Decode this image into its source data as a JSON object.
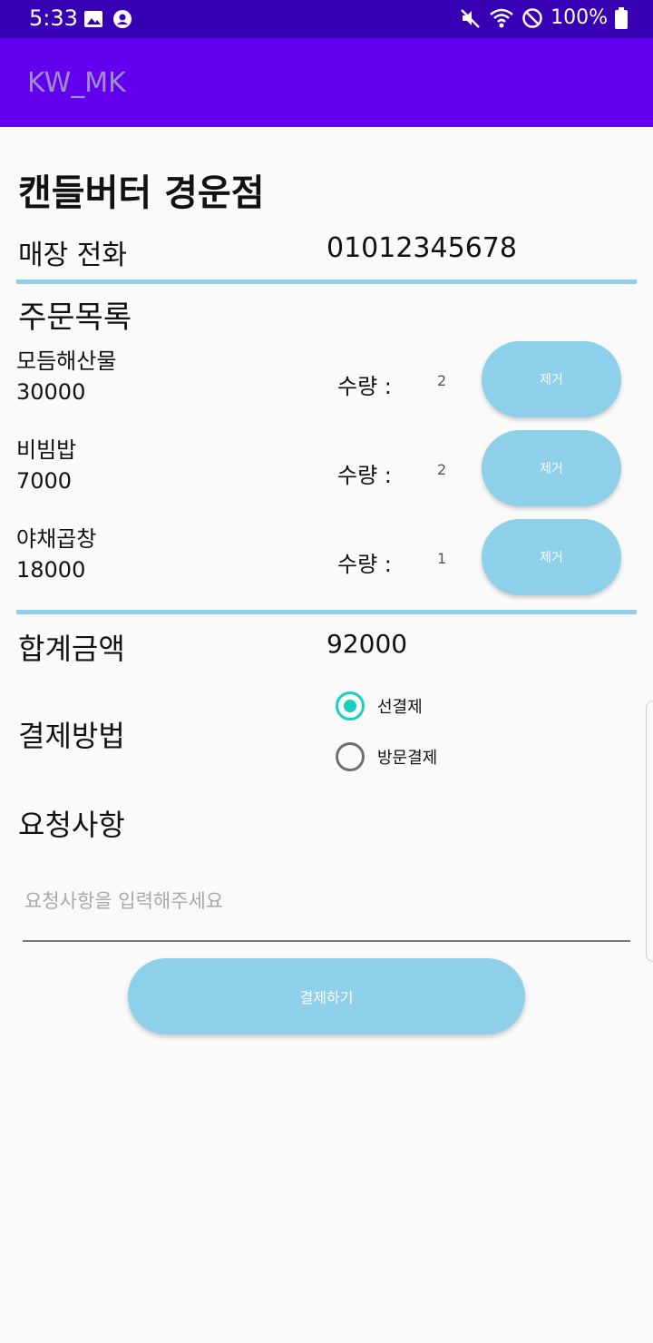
{
  "status_bar": {
    "time": "5:33",
    "battery_text": "100%",
    "icons": [
      "gallery-icon",
      "account-circle-icon",
      "mute-icon",
      "wifi-icon",
      "do-not-disturb-icon",
      "battery-icon"
    ]
  },
  "app_bar": {
    "title": "KW_MK"
  },
  "store": {
    "name": "캔들버터 경운점",
    "phone_label": "매장 전화",
    "phone_value": "01012345678"
  },
  "order": {
    "title": "주문목록",
    "qty_label": "수량 :",
    "remove_label": "제거",
    "items": [
      {
        "name": "모듬해산물",
        "price": "30000",
        "qty": "2"
      },
      {
        "name": "비빔밥",
        "price": "7000",
        "qty": "2"
      },
      {
        "name": "야채곱창",
        "price": "18000",
        "qty": "1"
      }
    ]
  },
  "total": {
    "label": "합계금액",
    "value": "92000"
  },
  "payment": {
    "label": "결제방법",
    "options": [
      {
        "label": "선결제",
        "selected": true
      },
      {
        "label": "방문결제",
        "selected": false
      }
    ]
  },
  "request": {
    "label": "요청사항",
    "placeholder": "요청사항을 입력해주세요",
    "value": ""
  },
  "pay_button": {
    "label": "결제하기"
  },
  "colors": {
    "status_bar": "#3700b3",
    "app_bar": "#6200ee",
    "accent_blue": "#8ecfe9",
    "radio_checked": "#17d0c0"
  }
}
